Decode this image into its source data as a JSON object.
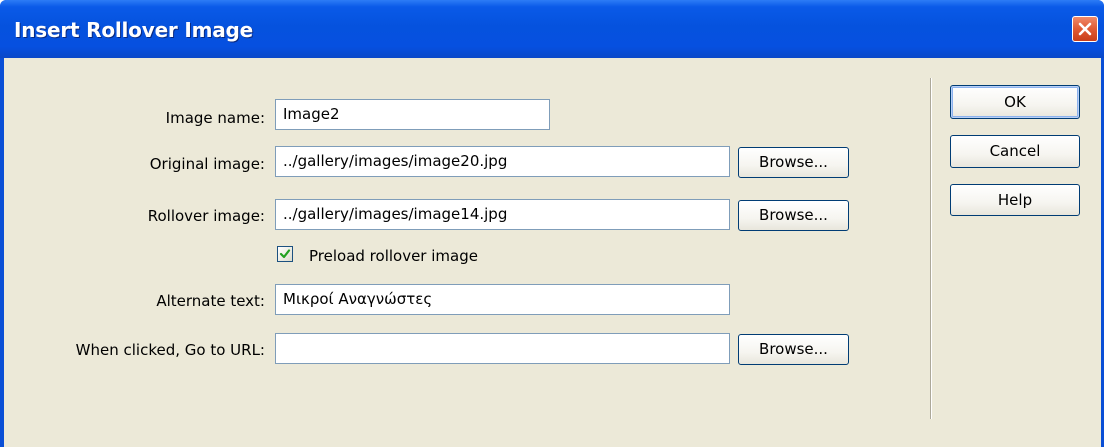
{
  "window": {
    "title": "Insert Rollover Image"
  },
  "form": {
    "image_name": {
      "label": "Image name:",
      "value": "Image2"
    },
    "original_image": {
      "label": "Original image:",
      "value": "../gallery/images/image20.jpg"
    },
    "rollover_image": {
      "label": "Rollover image:",
      "value": "../gallery/images/image14.jpg"
    },
    "preload": {
      "label": "Preload rollover image",
      "checked": true
    },
    "alternate_text": {
      "label": "Alternate text:",
      "value": "Μικροί Αναγνώστες"
    },
    "go_to_url": {
      "label": "When clicked, Go to URL:",
      "value": ""
    },
    "browse_label": "Browse..."
  },
  "actions": {
    "ok": "OK",
    "cancel": "Cancel",
    "help": "Help"
  },
  "icons": {
    "close": "close-icon",
    "checkmark": "checkmark-icon"
  },
  "colors": {
    "titlebar": "#0552de",
    "dialog_bg": "#ece9d8",
    "close_button": "#e05a34",
    "check": "#21a121"
  }
}
